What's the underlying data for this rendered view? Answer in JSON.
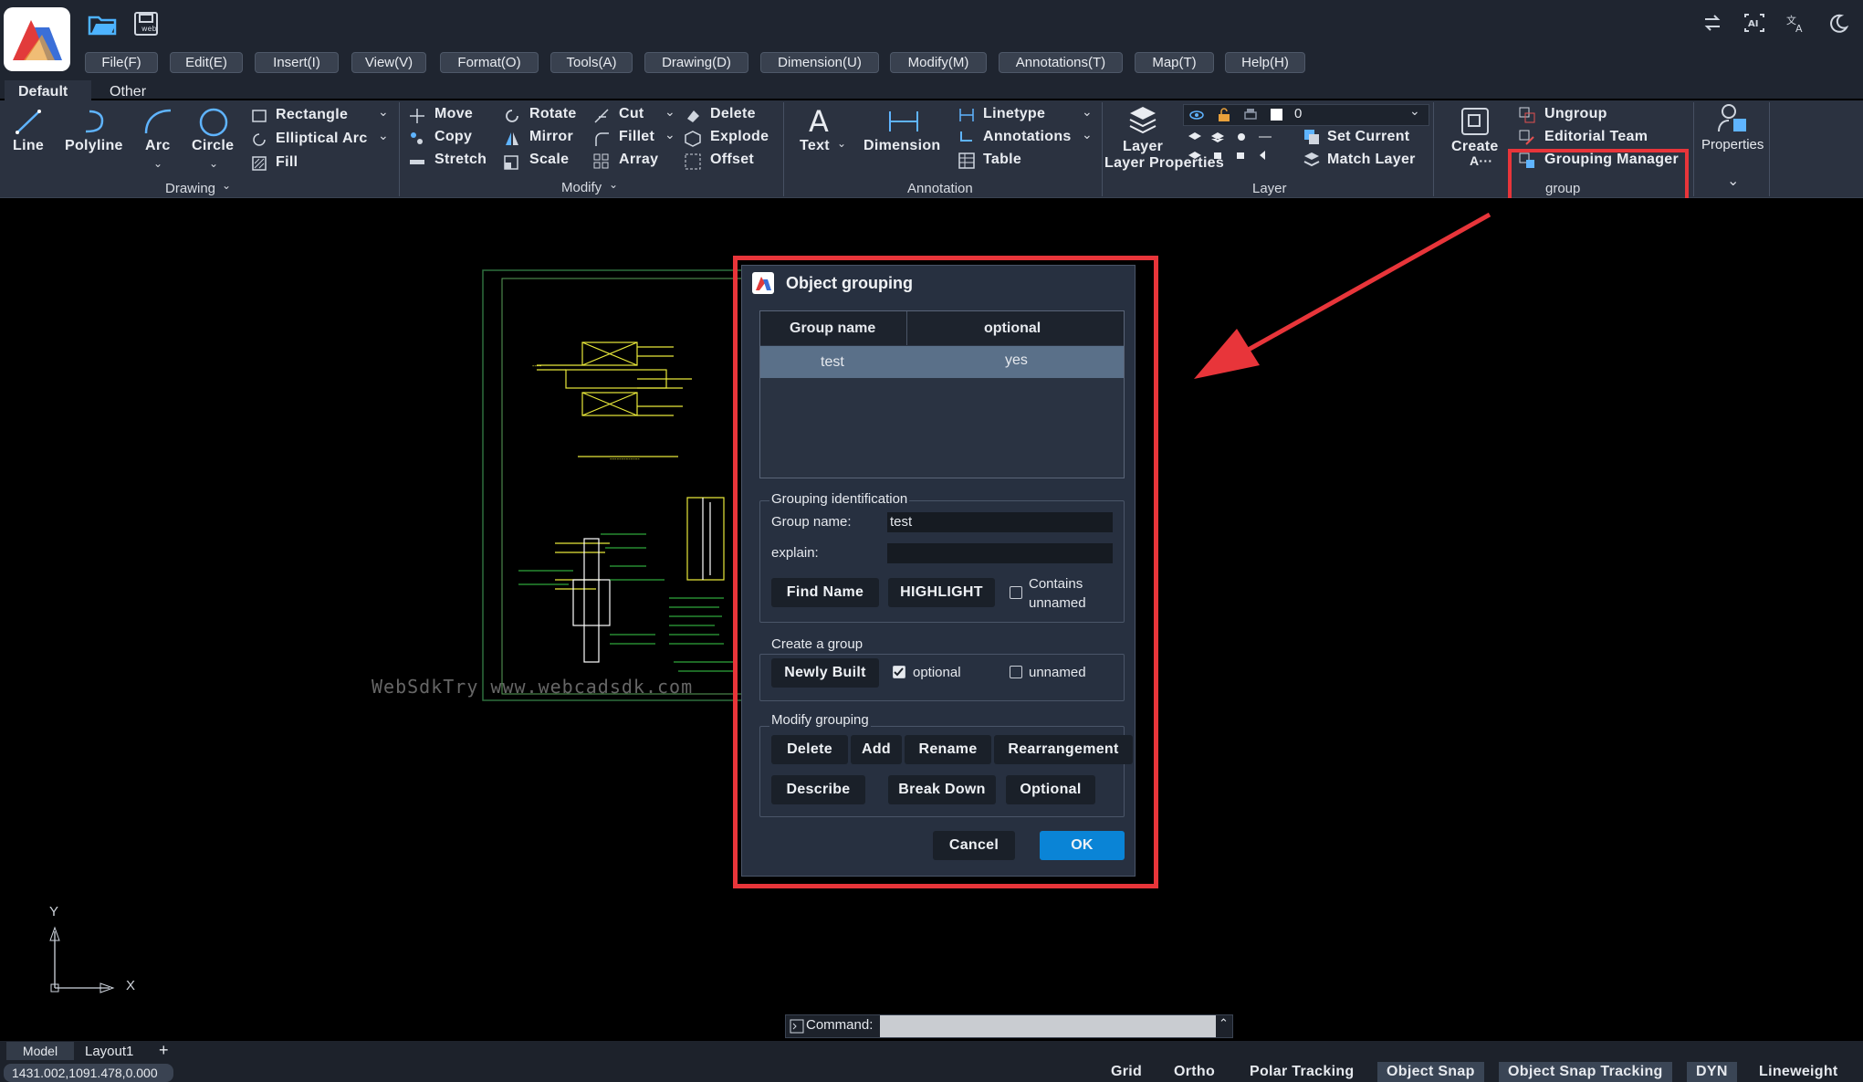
{
  "menu": [
    "File(F)",
    "Edit(E)",
    "Insert(I)",
    "View(V)",
    "Format(O)",
    "Tools(A)",
    "Drawing(D)",
    "Dimension(U)",
    "Modify(M)",
    "Annotations(T)",
    "Map(T)",
    "Help(H)"
  ],
  "tabs": {
    "default": "Default",
    "other": "Other"
  },
  "ribbon": {
    "drawing": {
      "line": "Line",
      "polyline": "Polyline",
      "arc": "Arc",
      "circle": "Circle",
      "rectangle": "Rectangle",
      "elliptical_arc": "Elliptical Arc",
      "fill": "Fill",
      "group": "Drawing"
    },
    "modify": {
      "move": "Move",
      "copy": "Copy",
      "stretch": "Stretch",
      "rotate": "Rotate",
      "mirror": "Mirror",
      "scale": "Scale",
      "cut": "Cut",
      "fillet": "Fillet",
      "array": "Array",
      "delete": "Delete",
      "explode": "Explode",
      "offset": "Offset",
      "group": "Modify"
    },
    "annotation": {
      "text": "Text",
      "dimension": "Dimension",
      "linetype": "Linetype",
      "annotations": "Annotations",
      "table": "Table",
      "group": "Annotation"
    },
    "layer": {
      "layer_properties": "Layer Properties",
      "layer_value": "0",
      "set_current": "Set Current",
      "match_layer": "Match Layer",
      "group": "Layer"
    },
    "group": {
      "create": "Create A…",
      "ungroup": "Ungroup",
      "editorial_team": "Editorial Team",
      "grouping_manager": "Grouping Manager",
      "group": "group"
    },
    "properties": {
      "label": "Properties"
    }
  },
  "canvas": {
    "watermark": "WebSdkTry www.webcadsdk.com",
    "axis_y": "Y",
    "axis_x": "X"
  },
  "dialog": {
    "title": "Object grouping",
    "table": {
      "headers": [
        "Group name",
        "optional"
      ],
      "rows": [
        {
          "name": "test",
          "optional": "yes"
        }
      ]
    },
    "identification": {
      "legend": "Grouping identification",
      "name_label": "Group name:",
      "name_value": "test",
      "explain_label": "explain:",
      "explain_value": "",
      "find_name": "Find Name",
      "highlight": "HIGHLIGHT",
      "contains_unnamed": "Contains unnamed"
    },
    "create": {
      "legend": "Create a group",
      "newly_built": "Newly Built",
      "optional": "optional",
      "unnamed": "unnamed"
    },
    "modify": {
      "legend": "Modify grouping",
      "delete": "Delete",
      "add": "Add",
      "rename": "Rename",
      "rearrangement": "Rearrangement",
      "describe": "Describe",
      "break_down": "Break Down",
      "optional": "Optional"
    },
    "cancel": "Cancel",
    "ok": "OK"
  },
  "command": {
    "label": "Command:",
    "value": ""
  },
  "layout_tabs": {
    "model": "Model",
    "layout1": "Layout1",
    "add": "+"
  },
  "status": {
    "coords": "1431.002,1091.478,0.000",
    "grid": "Grid",
    "ortho": "Ortho",
    "polar": "Polar Tracking",
    "osnap": "Object Snap",
    "otrack": "Object Snap Tracking",
    "dyn": "DYN",
    "lineweight": "Lineweight"
  },
  "colors": {
    "accent": "#0a84d6",
    "highlight": "#e8353a",
    "selected_row": "#5a7089"
  }
}
